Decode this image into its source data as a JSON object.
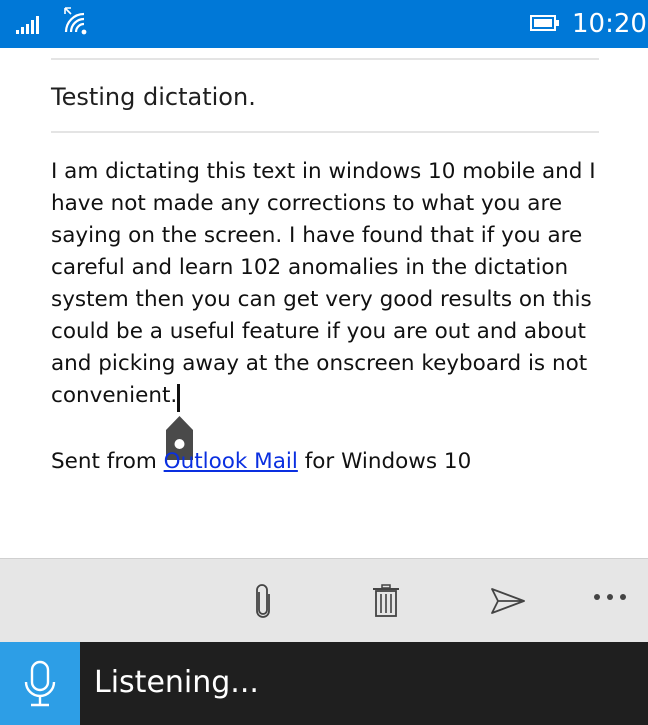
{
  "status_bar": {
    "time": "10:20",
    "icons": [
      "signal-icon",
      "wifi-icon",
      "battery-icon"
    ]
  },
  "compose": {
    "subject": "Testing dictation.",
    "body": "I am dictating this text in windows 10 mobile and I have not made any corrections to what you are saying on the screen. I have found that if you are careful and learn 102 anomalies in the dictation system then you can get very good results on this could be a useful feature if you are out and about and picking away at the onscreen keyboard is not convenient.",
    "signature_prefix": "Sent from ",
    "signature_link": "Outlook Mail",
    "signature_suffix": " for Windows 10"
  },
  "app_bar": {
    "icons": [
      "paperclip-icon",
      "trash-icon",
      "send-icon",
      "more-icon"
    ]
  },
  "dictation": {
    "status": "Listening...",
    "icon": "microphone-icon"
  },
  "colors": {
    "accent": "#0078d7",
    "mic_button": "#2d9ee6",
    "dictation_bar": "#1f1f1f",
    "app_bar": "#e6e6e6",
    "link": "#0a2fe0"
  }
}
